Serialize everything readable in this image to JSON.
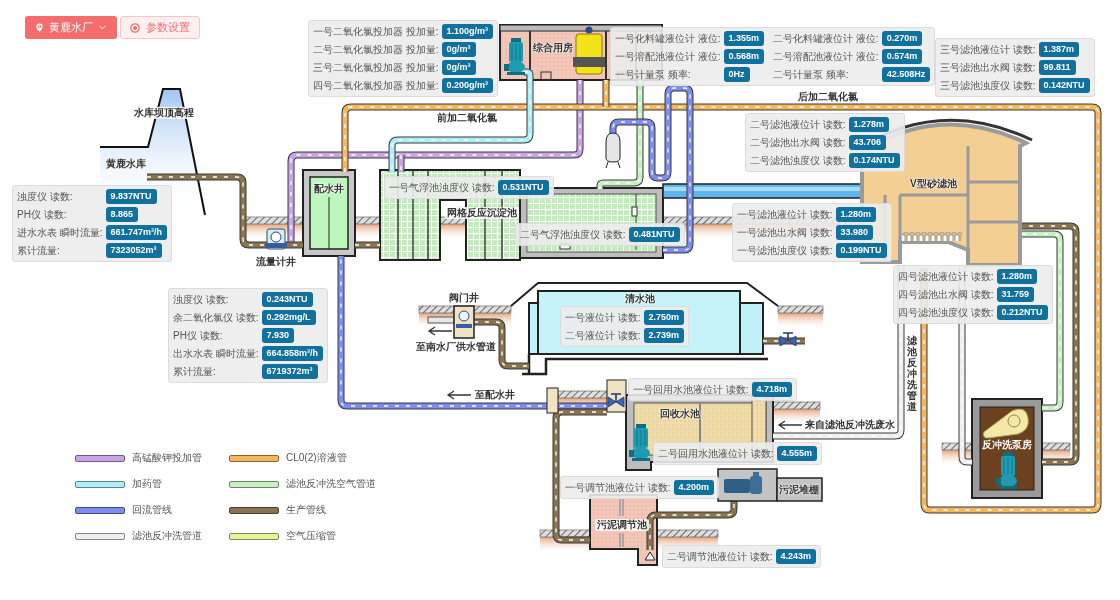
{
  "toolbar": {
    "plant_selector": "黄鹿水厂",
    "settings_button": "参数设置"
  },
  "labels": {
    "dam": "水库坝顶高程",
    "reservoir": "黄鹿水库",
    "flow_meter_well": "流量计井",
    "distribution_well": "配水井",
    "service_building": "综合用房",
    "pre_dosing": "前加二氧化氯",
    "post_dosing": "后加二氧化氯",
    "sedimentation_tank": "网格反应沉淀池",
    "v_filter": "V型砂滤池",
    "clear_water_tank": "清水池",
    "valve_well": "阀门井",
    "outlet_pipe": "至南水厂供水管道",
    "to_distribution_well": "至配水井",
    "recycle_pool": "回收水池",
    "backwash_waste": "来自滤池反冲洗废水",
    "backwash_drain": "滤池反冲洗管道",
    "sludge_tank": "污泥调节池",
    "sludge_shed": "污泥堆棚",
    "backwash_pump_house": "反冲洗泵房"
  },
  "doser_readings": [
    {
      "label": "一号二氧化氯投加器 投加量:",
      "value": "1.100g/m³"
    },
    {
      "label": "二号二氧化氯投加器 投加量:",
      "value": "0g/m³"
    },
    {
      "label": "三号二氧化氯投加器 投加量:",
      "value": "0g/m³"
    },
    {
      "label": "四号二氧化氯投加器 投加量:",
      "value": "0.200g/m³"
    }
  ],
  "tank_readings": [
    [
      {
        "label": "一号化料罐液位计 液位:",
        "value": "1.355m"
      },
      {
        "label": "二号化料罐液位计 液位:",
        "value": "0.270m"
      }
    ],
    [
      {
        "label": "一号溶配池液位计 液位:",
        "value": "0.568m"
      },
      {
        "label": "二号溶配池液位计 液位:",
        "value": "0.574m"
      }
    ],
    [
      {
        "label": "一号计量泵 频率:",
        "value": "0Hz"
      },
      {
        "label": "二号计量泵 频率:",
        "value": "42.508Hz"
      }
    ]
  ],
  "filter_3_readings": [
    {
      "label": "三号滤池液位计 读数:",
      "value": "1.387m"
    },
    {
      "label": "三号滤池出水阀 读数:",
      "value": "99.811"
    },
    {
      "label": "三号滤池浊度仪 读数:",
      "value": "0.142NTU"
    }
  ],
  "filter_2_readings": [
    {
      "label": "二号滤池液位计 读数:",
      "value": "1.278m"
    },
    {
      "label": "二号滤池出水阀 读数:",
      "value": "43.706"
    },
    {
      "label": "二号滤池浊度仪 读数:",
      "value": "0.174NTU"
    }
  ],
  "inlet_readings": [
    {
      "label": "浊度仪 读数:",
      "value": "9.837NTU"
    },
    {
      "label": "PH仪 读数:",
      "value": "8.865"
    },
    {
      "label": "进水水表 瞬时流量:",
      "value": "661.747m³/h"
    },
    {
      "label": "累计流量:",
      "value": "7323052m³"
    }
  ],
  "flotation_readings": [
    {
      "label": "一号气浮池浊度仪 读数:",
      "value": "0.531NTU"
    },
    {
      "label": "二号气浮池浊度仪 读数:",
      "value": "0.481NTU"
    }
  ],
  "filter_1_readings": [
    {
      "label": "一号滤池液位计 读数:",
      "value": "1.280m"
    },
    {
      "label": "一号滤池出水阀 读数:",
      "value": "33.980"
    },
    {
      "label": "一号滤池浊度仪 读数:",
      "value": "0.199NTU"
    }
  ],
  "filter_4_readings": [
    {
      "label": "四号滤池液位计 读数:",
      "value": "1.280m"
    },
    {
      "label": "四号滤池出水阀 读数:",
      "value": "31.759"
    },
    {
      "label": "四号滤池浊度仪 读数:",
      "value": "0.212NTU"
    }
  ],
  "outlet_readings": [
    {
      "label": "浊度仪 读数:",
      "value": "0.243NTU"
    },
    {
      "label": "余二氧化氯仪 读数:",
      "value": "0.292mg/L"
    },
    {
      "label": "PH仪 读数:",
      "value": "7.930"
    },
    {
      "label": "出水水表 瞬时流量:",
      "value": "664.858m³/h"
    },
    {
      "label": "累计流量:",
      "value": "6719372m³"
    }
  ],
  "clear_water_readings": [
    {
      "label": "一号液位计 读数:",
      "value": "2.750m"
    },
    {
      "label": "二号液位计 读数:",
      "value": "2.739m"
    }
  ],
  "recycle_pool_readings": [
    {
      "label": "一号回用水池液位计 读数:",
      "value": "4.718m"
    },
    {
      "label": "二号回用水池液位计 读数:",
      "value": "4.555m"
    }
  ],
  "sludge_tank_readings": [
    {
      "label": "一号调节池液位计 读数:",
      "value": "4.200m"
    },
    {
      "label": "二号调节池液位计 读数:",
      "value": "4.243m"
    }
  ],
  "legend": [
    {
      "label": "高锰酸钾投加管",
      "color": "#c9a3e8"
    },
    {
      "label": "CL0(2)溶液管",
      "color": "#f5b65c"
    },
    {
      "label": "加药管",
      "color": "#adeef7"
    },
    {
      "label": "滤池反冲洗空气管道",
      "color": "#c8f0c2"
    },
    {
      "label": "回流管线",
      "color": "#7d8cf0"
    },
    {
      "label": "生产管线",
      "color": "#8a7450"
    },
    {
      "label": "滤池反冲洗管道",
      "color": "#efefef"
    },
    {
      "label": "空气压缩管",
      "color": "#e4f59b"
    }
  ]
}
